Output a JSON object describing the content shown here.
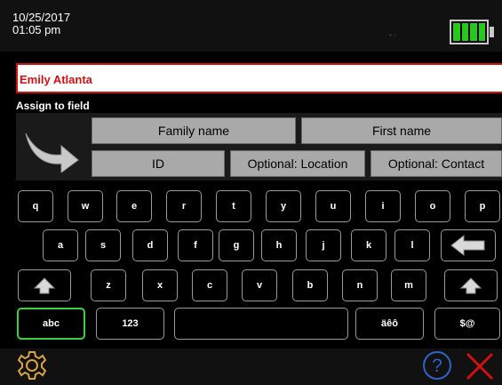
{
  "status": {
    "date": "10/25/2017",
    "time": "01:05 pm"
  },
  "name_field": {
    "value": "Emily Atlanta"
  },
  "assign": {
    "label": "Assign to field",
    "fields": [
      "Family name",
      "First name",
      "ID",
      "Optional: Location",
      "Optional: Contact"
    ]
  },
  "keyboard": {
    "row1": [
      "q",
      "w",
      "e",
      "r",
      "t",
      "y",
      "u",
      "i",
      "o",
      "p"
    ],
    "row2": [
      "a",
      "s",
      "d",
      "f",
      "g",
      "h",
      "j",
      "k",
      "l"
    ],
    "row3": [
      "z",
      "x",
      "c",
      "v",
      "b",
      "n",
      "m"
    ],
    "row4": {
      "abc": "abc",
      "num": "123",
      "space": "",
      "accents": "äêô",
      "symbols": "$@"
    }
  },
  "icons": {
    "shift": "shift-up-arrow-icon",
    "backspace": "backspace-arrow-icon",
    "settings": "gear-icon",
    "help": "question-mark-icon",
    "close": "close-x-icon",
    "battery": "battery-icon",
    "assign_arrow": "curved-arrow-icon"
  },
  "colors": {
    "accent_red": "#d21010",
    "battery_green": "#27c71c",
    "active_key": "#3bd13b",
    "field_button": "#a9a9a9",
    "settings_icon": "#d9a441",
    "help_icon": "#2f63c9"
  }
}
